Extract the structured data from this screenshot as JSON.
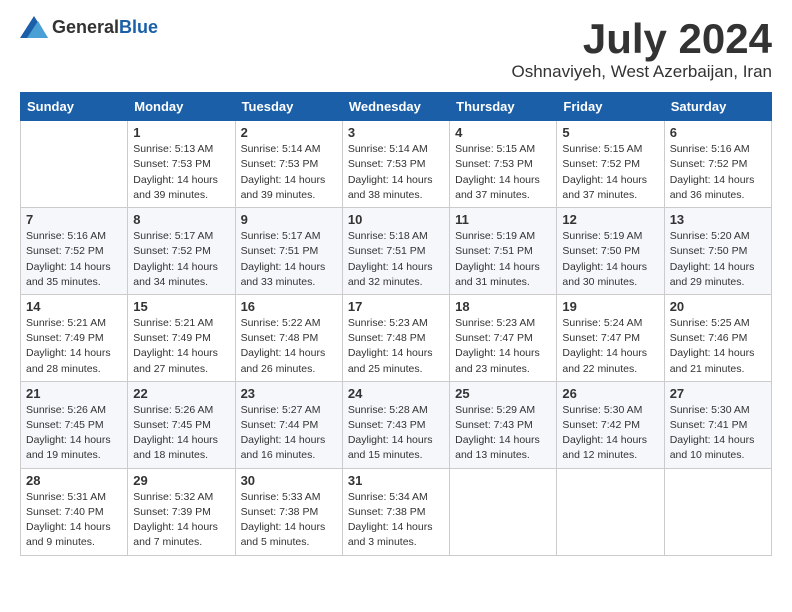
{
  "logo": {
    "text_general": "General",
    "text_blue": "Blue"
  },
  "header": {
    "month_year": "July 2024",
    "location": "Oshnaviyeh, West Azerbaijan, Iran"
  },
  "days_of_week": [
    "Sunday",
    "Monday",
    "Tuesday",
    "Wednesday",
    "Thursday",
    "Friday",
    "Saturday"
  ],
  "weeks": [
    [
      {
        "day": "",
        "info": ""
      },
      {
        "day": "1",
        "info": "Sunrise: 5:13 AM\nSunset: 7:53 PM\nDaylight: 14 hours\nand 39 minutes."
      },
      {
        "day": "2",
        "info": "Sunrise: 5:14 AM\nSunset: 7:53 PM\nDaylight: 14 hours\nand 39 minutes."
      },
      {
        "day": "3",
        "info": "Sunrise: 5:14 AM\nSunset: 7:53 PM\nDaylight: 14 hours\nand 38 minutes."
      },
      {
        "day": "4",
        "info": "Sunrise: 5:15 AM\nSunset: 7:53 PM\nDaylight: 14 hours\nand 37 minutes."
      },
      {
        "day": "5",
        "info": "Sunrise: 5:15 AM\nSunset: 7:52 PM\nDaylight: 14 hours\nand 37 minutes."
      },
      {
        "day": "6",
        "info": "Sunrise: 5:16 AM\nSunset: 7:52 PM\nDaylight: 14 hours\nand 36 minutes."
      }
    ],
    [
      {
        "day": "7",
        "info": "Sunrise: 5:16 AM\nSunset: 7:52 PM\nDaylight: 14 hours\nand 35 minutes."
      },
      {
        "day": "8",
        "info": "Sunrise: 5:17 AM\nSunset: 7:52 PM\nDaylight: 14 hours\nand 34 minutes."
      },
      {
        "day": "9",
        "info": "Sunrise: 5:17 AM\nSunset: 7:51 PM\nDaylight: 14 hours\nand 33 minutes."
      },
      {
        "day": "10",
        "info": "Sunrise: 5:18 AM\nSunset: 7:51 PM\nDaylight: 14 hours\nand 32 minutes."
      },
      {
        "day": "11",
        "info": "Sunrise: 5:19 AM\nSunset: 7:51 PM\nDaylight: 14 hours\nand 31 minutes."
      },
      {
        "day": "12",
        "info": "Sunrise: 5:19 AM\nSunset: 7:50 PM\nDaylight: 14 hours\nand 30 minutes."
      },
      {
        "day": "13",
        "info": "Sunrise: 5:20 AM\nSunset: 7:50 PM\nDaylight: 14 hours\nand 29 minutes."
      }
    ],
    [
      {
        "day": "14",
        "info": "Sunrise: 5:21 AM\nSunset: 7:49 PM\nDaylight: 14 hours\nand 28 minutes."
      },
      {
        "day": "15",
        "info": "Sunrise: 5:21 AM\nSunset: 7:49 PM\nDaylight: 14 hours\nand 27 minutes."
      },
      {
        "day": "16",
        "info": "Sunrise: 5:22 AM\nSunset: 7:48 PM\nDaylight: 14 hours\nand 26 minutes."
      },
      {
        "day": "17",
        "info": "Sunrise: 5:23 AM\nSunset: 7:48 PM\nDaylight: 14 hours\nand 25 minutes."
      },
      {
        "day": "18",
        "info": "Sunrise: 5:23 AM\nSunset: 7:47 PM\nDaylight: 14 hours\nand 23 minutes."
      },
      {
        "day": "19",
        "info": "Sunrise: 5:24 AM\nSunset: 7:47 PM\nDaylight: 14 hours\nand 22 minutes."
      },
      {
        "day": "20",
        "info": "Sunrise: 5:25 AM\nSunset: 7:46 PM\nDaylight: 14 hours\nand 21 minutes."
      }
    ],
    [
      {
        "day": "21",
        "info": "Sunrise: 5:26 AM\nSunset: 7:45 PM\nDaylight: 14 hours\nand 19 minutes."
      },
      {
        "day": "22",
        "info": "Sunrise: 5:26 AM\nSunset: 7:45 PM\nDaylight: 14 hours\nand 18 minutes."
      },
      {
        "day": "23",
        "info": "Sunrise: 5:27 AM\nSunset: 7:44 PM\nDaylight: 14 hours\nand 16 minutes."
      },
      {
        "day": "24",
        "info": "Sunrise: 5:28 AM\nSunset: 7:43 PM\nDaylight: 14 hours\nand 15 minutes."
      },
      {
        "day": "25",
        "info": "Sunrise: 5:29 AM\nSunset: 7:43 PM\nDaylight: 14 hours\nand 13 minutes."
      },
      {
        "day": "26",
        "info": "Sunrise: 5:30 AM\nSunset: 7:42 PM\nDaylight: 14 hours\nand 12 minutes."
      },
      {
        "day": "27",
        "info": "Sunrise: 5:30 AM\nSunset: 7:41 PM\nDaylight: 14 hours\nand 10 minutes."
      }
    ],
    [
      {
        "day": "28",
        "info": "Sunrise: 5:31 AM\nSunset: 7:40 PM\nDaylight: 14 hours\nand 9 minutes."
      },
      {
        "day": "29",
        "info": "Sunrise: 5:32 AM\nSunset: 7:39 PM\nDaylight: 14 hours\nand 7 minutes."
      },
      {
        "day": "30",
        "info": "Sunrise: 5:33 AM\nSunset: 7:38 PM\nDaylight: 14 hours\nand 5 minutes."
      },
      {
        "day": "31",
        "info": "Sunrise: 5:34 AM\nSunset: 7:38 PM\nDaylight: 14 hours\nand 3 minutes."
      },
      {
        "day": "",
        "info": ""
      },
      {
        "day": "",
        "info": ""
      },
      {
        "day": "",
        "info": ""
      }
    ]
  ]
}
